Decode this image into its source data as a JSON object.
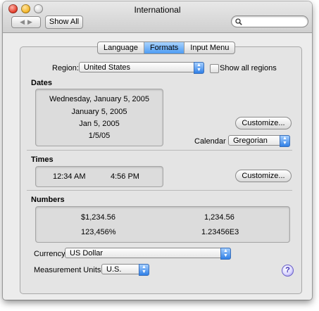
{
  "window": {
    "title": "International",
    "show_all_label": "Show All",
    "search_placeholder": ""
  },
  "icons": {
    "back": "◀",
    "forward": "▶",
    "search": "🔍",
    "select_arrows": "▲▼",
    "help": "?"
  },
  "tabs": [
    {
      "label": "Language",
      "active": false
    },
    {
      "label": "Formats",
      "active": true
    },
    {
      "label": "Input Menu",
      "active": false
    }
  ],
  "region": {
    "label": "Region:",
    "value": "United States",
    "show_all_regions_label": "Show all regions",
    "show_all_regions_checked": false
  },
  "dates": {
    "heading": "Dates",
    "examples": [
      "Wednesday, January 5, 2005",
      "January 5, 2005",
      "Jan 5, 2005",
      "1/5/05"
    ],
    "customize_label": "Customize...",
    "calendar_label": "Calendar",
    "calendar_value": "Gregorian"
  },
  "times": {
    "heading": "Times",
    "examples": [
      "12:34 AM",
      "4:56 PM"
    ],
    "customize_label": "Customize..."
  },
  "numbers": {
    "heading": "Numbers",
    "examples": [
      "$1,234.56",
      "1,234.56",
      "123,456%",
      "1.23456E3"
    ]
  },
  "currency": {
    "label": "Currency",
    "value": "US Dollar"
  },
  "measurement": {
    "label": "Measurement Units",
    "value": "U.S."
  },
  "colors": {
    "accent": "#4d9cf3",
    "window_bg": "#ececec"
  }
}
